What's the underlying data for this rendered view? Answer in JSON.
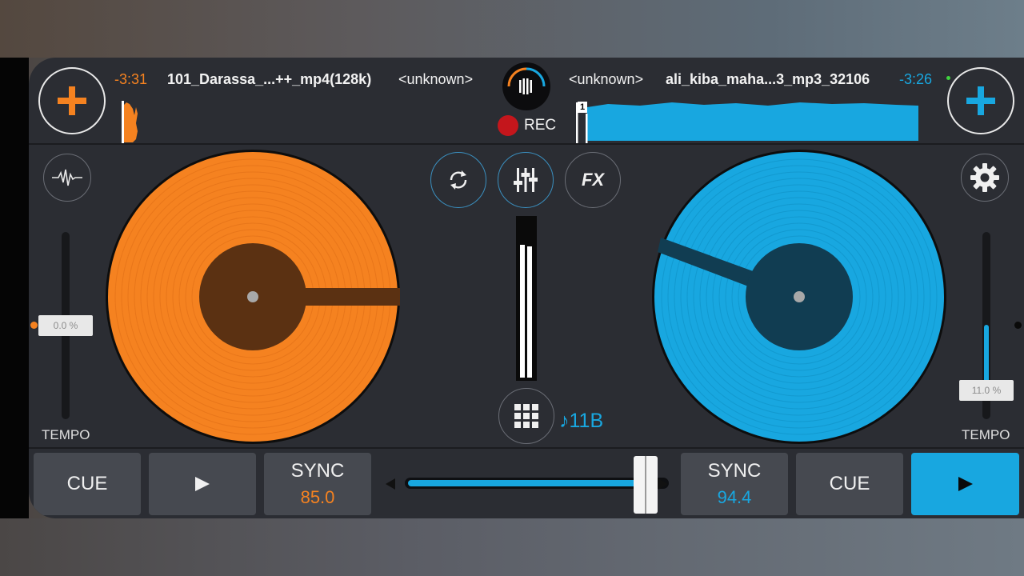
{
  "colors": {
    "deck_a": "#f58220",
    "deck_b": "#18a7e0",
    "background": "#2b2d33",
    "button": "#464950"
  },
  "deck_a": {
    "add_icon": "plus-icon",
    "time": "-3:31",
    "title": "101_Darassa_...++_mp4(128k)",
    "artist": "<unknown>",
    "tempo_value": "0.0 %",
    "tempo_label": "TEMPO",
    "tempo_level": 0.5,
    "cue_label": "CUE",
    "play_icon": "play-icon",
    "sync_label": "SYNC",
    "bpm": "85.0",
    "waveform_icon": "waveform-icon"
  },
  "deck_b": {
    "add_icon": "plus-icon",
    "time": "-3:26",
    "title": "ali_kiba_maha...3_mp3_32106",
    "artist": "<unknown>",
    "cue_marker": "1",
    "tempo_value": "11.0 %",
    "tempo_label": "TEMPO",
    "tempo_level": 0.11,
    "cue_label": "CUE",
    "play_icon": "play-icon",
    "sync_label": "SYNC",
    "bpm": "94.4",
    "settings_icon": "gear-icon"
  },
  "center": {
    "rec_label": "REC",
    "key": "♪11B",
    "fx_label": "FX",
    "loop_icon": "sync-icon",
    "mixer_icon": "mixer-icon",
    "grid_icon": "grid-icon",
    "vinyl_icon": "vinyl-icon",
    "crossfader_position": 0.96
  }
}
